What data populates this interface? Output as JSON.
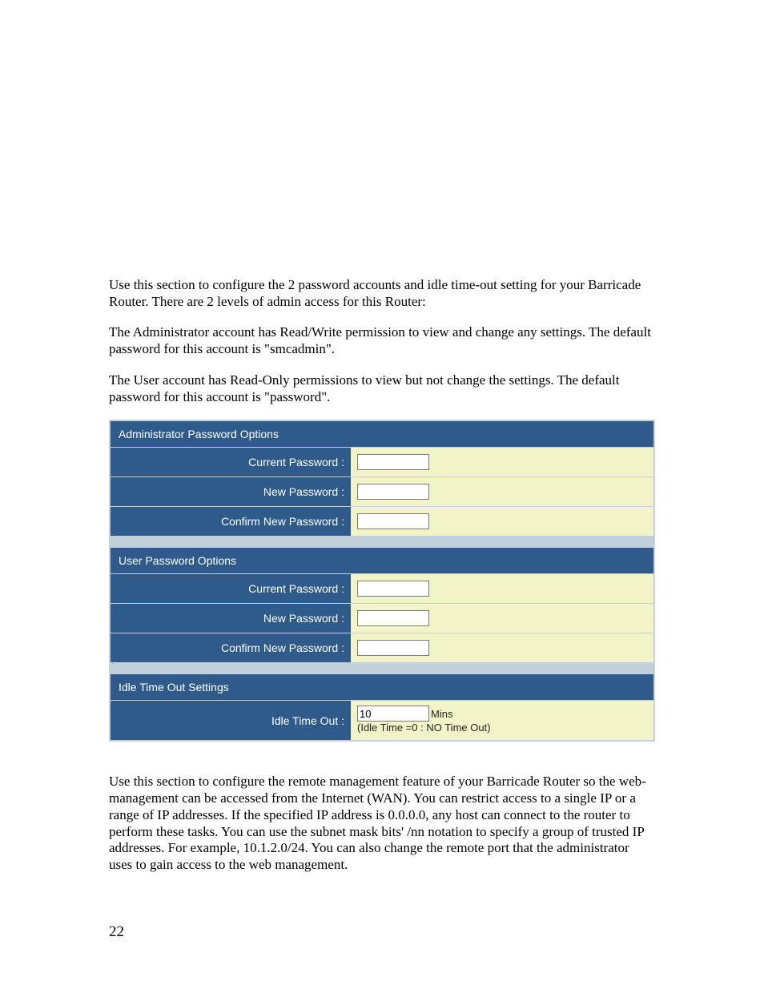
{
  "paragraphs": {
    "p1": "Use this section to configure the 2 password accounts and idle time-out setting for your Barricade Router. There are 2 levels of admin access for this Router:",
    "p2": "The Administrator account has Read/Write permission to view and change any settings. The default password for this account is \"smcadmin\".",
    "p3": "The User account has Read-Only permissions to view but not change the settings. The default password for this account is \"password\".",
    "p4": "Use this section to configure the remote management feature of your Barricade Router so the web-management can be accessed from the Internet (WAN). You can restrict access to a single IP or a range of IP addresses. If the specified IP address is 0.0.0.0, any host can connect to the router to perform these tasks. You can use the subnet mask bits' /nn notation to specify a group of trusted IP addresses. For example, 10.1.2.0/24. You can also change the remote port that the administrator uses to gain access to the web management."
  },
  "admin_section": {
    "header": "Administrator Password Options",
    "rows": {
      "current": "Current Password :",
      "new": "New Password :",
      "confirm": "Confirm New Password :"
    },
    "values": {
      "current": "",
      "new": "",
      "confirm": ""
    }
  },
  "user_section": {
    "header": "User Password Options",
    "rows": {
      "current": "Current Password :",
      "new": "New Password :",
      "confirm": "Confirm New Password :"
    },
    "values": {
      "current": "",
      "new": "",
      "confirm": ""
    }
  },
  "idle_section": {
    "header": "Idle Time Out Settings",
    "label": "Idle Time Out :",
    "value": "10",
    "unit": "Mins",
    "note": "(Idle Time =0 : NO Time Out)"
  },
  "page_number": "22"
}
